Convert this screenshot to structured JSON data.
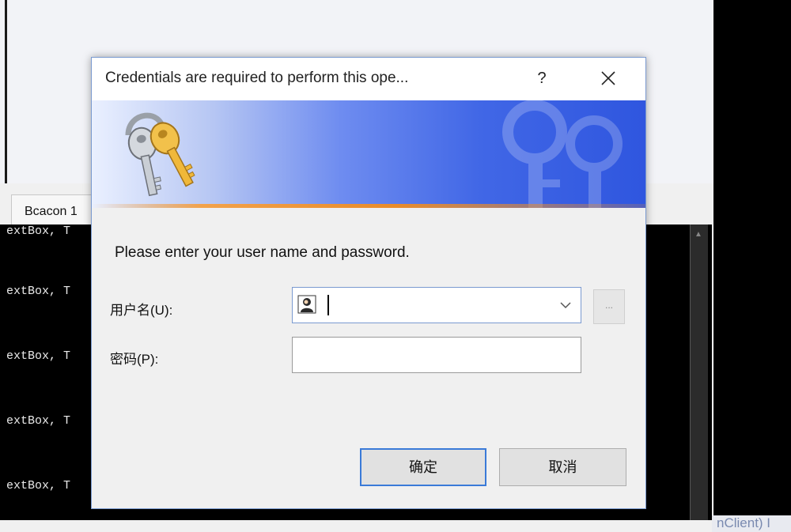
{
  "background": {
    "tab_label": "Bcacon 1",
    "console_lines": [
      "extBox, T",
      "extBox, T",
      "extBox, T",
      "extBox, T",
      "extBox, T"
    ],
    "bottom_right_text": "nClient) I"
  },
  "dialog": {
    "title": "Credentials are required to perform this ope...",
    "help_label": "?",
    "close_label": "✕",
    "prompt": "Please enter your user name and password.",
    "user_label": "用户名(U):",
    "user_value": "",
    "password_label": "密码(P):",
    "password_value": "",
    "browse_label": "...",
    "ok_label": "确定",
    "cancel_label": "取消"
  },
  "icons": {
    "banner": "keys-icon",
    "user": "user-icon",
    "dropdown": "chevron-down-icon",
    "close": "close-icon",
    "help": "help-icon"
  },
  "colors": {
    "banner_gradient_end": "#2f56df",
    "ok_border": "#3a7ad8",
    "console_bg": "#000000"
  }
}
